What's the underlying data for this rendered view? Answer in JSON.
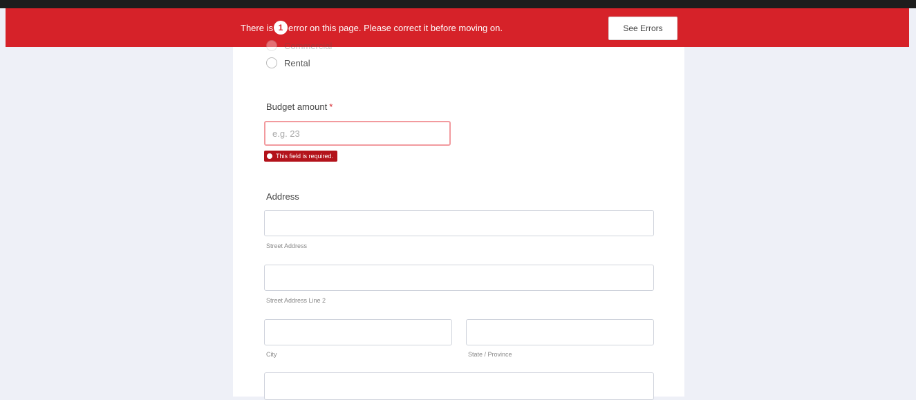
{
  "banner": {
    "text_before": "There is",
    "error_count": "1",
    "text_after": "error on this page. Please correct it before moving on.",
    "button_label": "See Errors",
    "background_color": "#d62229"
  },
  "form": {
    "radio_options": [
      {
        "label": "Commercial"
      },
      {
        "label": "Rental"
      }
    ],
    "budget": {
      "label": "Budget amount",
      "required_mark": "*",
      "placeholder": "e.g. 23",
      "value": "",
      "error_message": "This field is required."
    },
    "address": {
      "label": "Address",
      "street_sublabel": "Street Address",
      "street2_sublabel": "Street Address Line 2",
      "city_sublabel": "City",
      "state_sublabel": "State / Province"
    }
  }
}
